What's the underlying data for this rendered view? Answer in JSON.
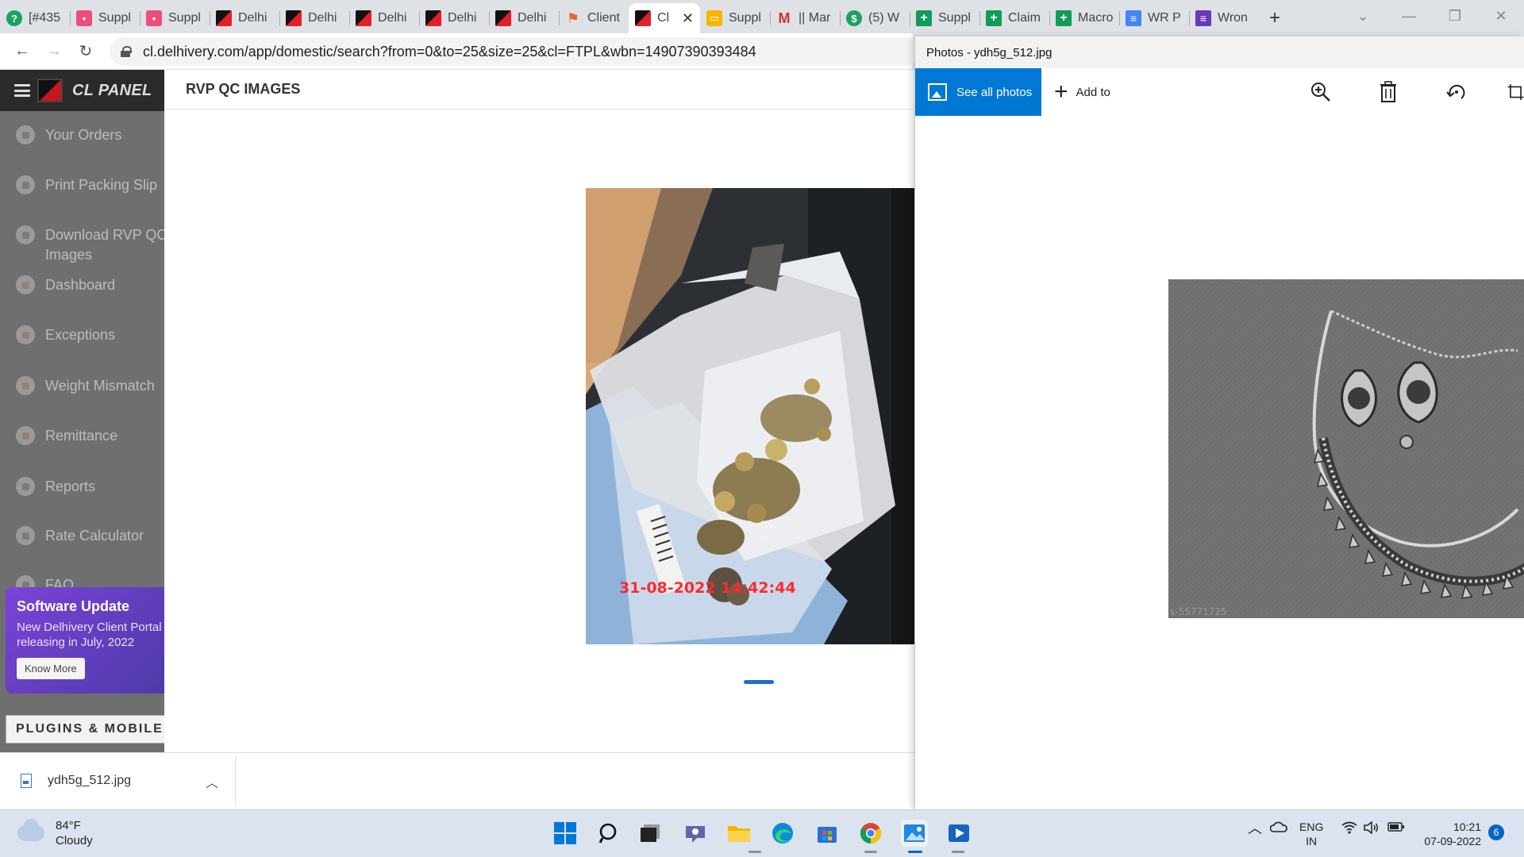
{
  "browser": {
    "tabs": [
      {
        "label": "[#435",
        "icon": "green-circle-icon"
      },
      {
        "label": "Suppl",
        "icon": "pink-app-icon"
      },
      {
        "label": "Suppl",
        "icon": "pink-app-icon"
      },
      {
        "label": "Delhi",
        "icon": "delhivery-icon"
      },
      {
        "label": "Delhi",
        "icon": "delhivery-icon"
      },
      {
        "label": "Delhi",
        "icon": "delhivery-icon"
      },
      {
        "label": "Delhi",
        "icon": "delhivery-icon"
      },
      {
        "label": "Delhi",
        "icon": "delhivery-icon"
      },
      {
        "label": "Client",
        "icon": "orange-flag-icon"
      },
      {
        "label": "Cl",
        "icon": "delhivery-icon",
        "active": true
      },
      {
        "label": "Suppl",
        "icon": "yellow-slides-icon"
      },
      {
        "label": "|| Mar",
        "icon": "gmail-icon"
      },
      {
        "label": "(5) W",
        "icon": "green-dollar-icon"
      },
      {
        "label": "Suppl",
        "icon": "sheets-icon"
      },
      {
        "label": "Claim",
        "icon": "sheets-icon"
      },
      {
        "label": "Macro",
        "icon": "sheets-icon"
      },
      {
        "label": "WR P",
        "icon": "docs-icon"
      },
      {
        "label": "Wron",
        "icon": "forms-icon"
      }
    ],
    "url": "cl.delhivery.com/app/domestic/search?from=0&to=25&size=25&cl=FTPL&wbn=14907390393484"
  },
  "panel": {
    "brand": "CL PANEL",
    "page_title": "RVP QC IMAGES",
    "nav": [
      {
        "label": "Your Orders",
        "icon": "orders-icon"
      },
      {
        "label": "Print Packing Slip",
        "icon": "print-icon"
      },
      {
        "label": "Download RVP QC Images",
        "icon": "download-icon"
      },
      {
        "label": "Dashboard",
        "icon": "dashboard-icon"
      },
      {
        "label": "Exceptions",
        "icon": "exceptions-icon"
      },
      {
        "label": "Weight Mismatch",
        "icon": "weight-icon"
      },
      {
        "label": "Remittance",
        "icon": "remittance-icon"
      },
      {
        "label": "Reports",
        "icon": "reports-icon"
      },
      {
        "label": "Rate Calculator",
        "icon": "calculator-icon"
      },
      {
        "label": "FAQ",
        "icon": "faq-icon"
      }
    ],
    "promo": {
      "title": "Software Update",
      "text": "New Delhivery Client Portal\nreleasing in July, 2022",
      "button": "Know More"
    },
    "plugins_label": "PLUGINS & MOBILE APP",
    "qc_photo_timestamp": "31-08-2022 14:42:44"
  },
  "download_bar": {
    "filename": "ydh5g_512.jpg"
  },
  "photos_app": {
    "title": "Photos - ydh5g_512.jpg",
    "see_all": "See all photos",
    "add_to": "Add to",
    "image_watermark": "s-55771725"
  },
  "taskbar": {
    "weather_temp": "84°F",
    "weather_desc": "Cloudy",
    "lang_top": "ENG",
    "lang_bottom": "IN",
    "time": "10:21",
    "date": "07-09-2022",
    "notifications": "6"
  }
}
